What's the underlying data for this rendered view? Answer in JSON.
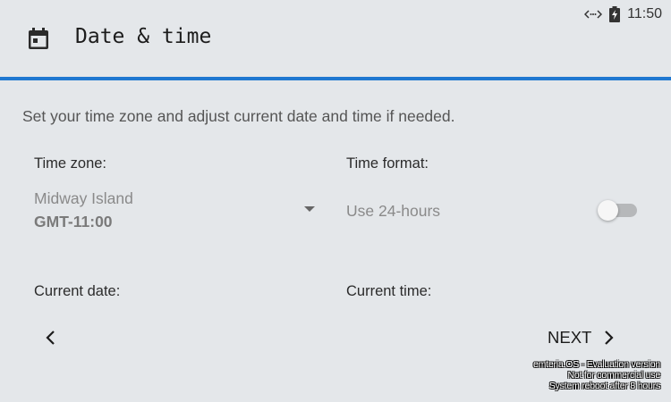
{
  "status_bar": {
    "time": "11:50",
    "icons": [
      "data-transfer-icon",
      "battery-charging-icon"
    ]
  },
  "header": {
    "title": "Date & time",
    "icon": "calendar-icon"
  },
  "intro": "Set your time zone and adjust current date and time if needed.",
  "time_zone": {
    "label": "Time zone:",
    "name": "Midway Island",
    "offset": "GMT-11:00"
  },
  "time_format": {
    "label": "Time format:",
    "option_label": "Use 24-hours",
    "enabled": false
  },
  "current_date": {
    "label": "Current date:"
  },
  "current_time": {
    "label": "Current time:"
  },
  "nav": {
    "next_label": "NEXT"
  },
  "watermark": {
    "line1": "emteria.OS - Evaluation version",
    "line2": "Not for commercial use",
    "line3": "System reboot after 8 hours"
  },
  "colors": {
    "accent": "#1f78d1",
    "background": "#e4e7ea"
  }
}
